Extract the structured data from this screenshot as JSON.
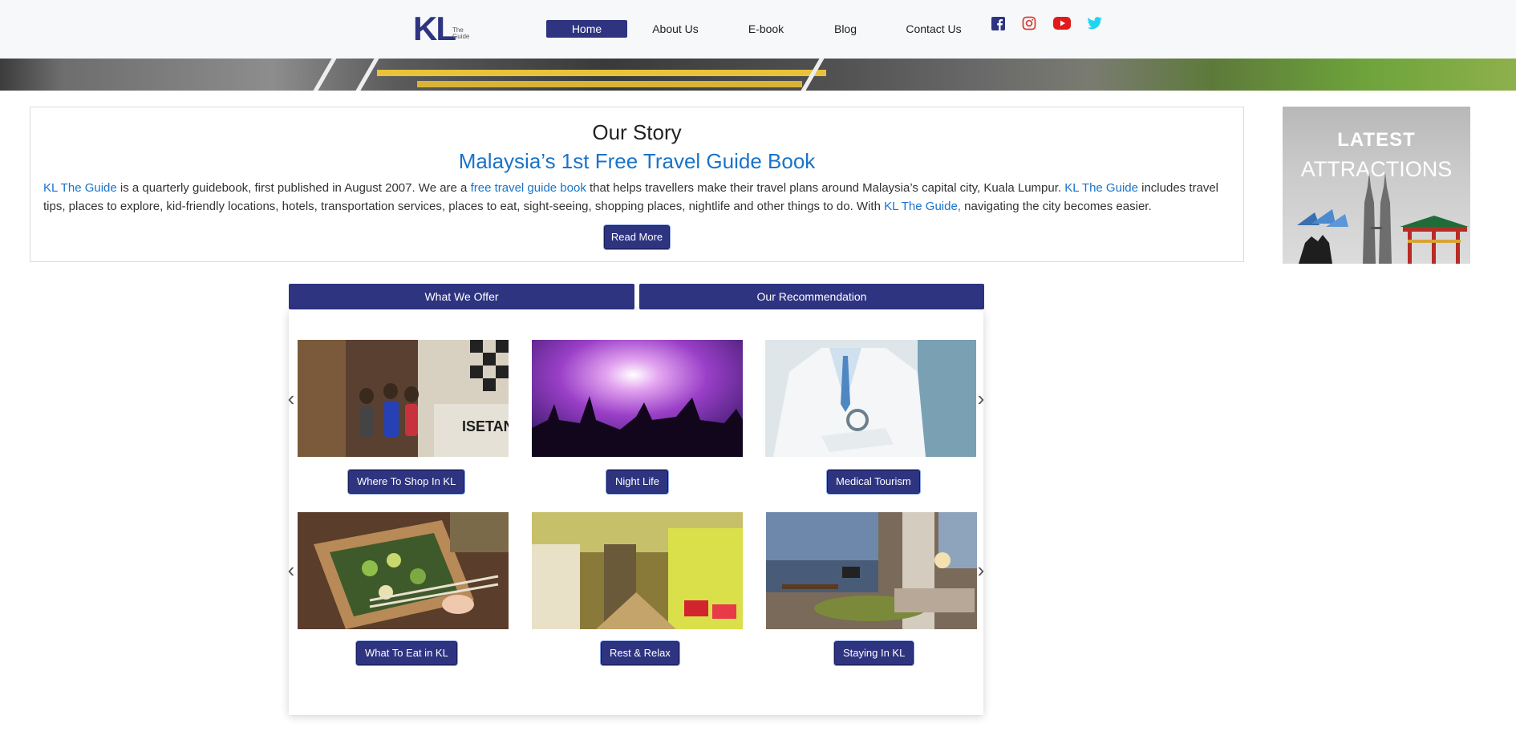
{
  "logo": {
    "main": "KL",
    "sub_line1": "The",
    "sub_line2": "Guide"
  },
  "nav": [
    {
      "label": "Home"
    },
    {
      "label": "About Us"
    },
    {
      "label": "E-book"
    },
    {
      "label": "Blog"
    },
    {
      "label": "Contact Us"
    }
  ],
  "social": [
    {
      "icon": "facebook-icon",
      "color": "#2e3480"
    },
    {
      "icon": "instagram-icon",
      "color": "#d0453a"
    },
    {
      "icon": "youtube-icon",
      "color": "#e11b1b"
    },
    {
      "icon": "twitter-icon",
      "color": "#1fd6f0"
    }
  ],
  "story": {
    "title": "Our Story",
    "subtitle": "Malaysia’s 1st Free Travel Guide Book",
    "p1_link": "KL The Guide",
    "p1_text": " is a quarterly guidebook, first published in August 2007. We are a ",
    "p2_link": "free travel guide book",
    "p2_text": " that helps travellers make their travel plans around Malaysia’s capital city, Kuala Lumpur. ",
    "p3_link": "KL The Guide",
    "p3_text": " includes travel tips, places to explore, kid-friendly locations, hotels, transportation services, places to eat, sight-seeing, shopping places, nightlife and other things to do. With ",
    "p4_link": "KL The Guide,",
    "p4_text": " navigating the city becomes easier.",
    "read_more": "Read More"
  },
  "latest": {
    "line1": "LATEST",
    "line2": "ATTRACTIONS"
  },
  "tabs": [
    {
      "label": "What We Offer"
    },
    {
      "label": "Our Recommendation"
    }
  ],
  "tiles": [
    {
      "label": "Where To Shop In KL"
    },
    {
      "label": "Night Life"
    },
    {
      "label": "Medical Tourism"
    },
    {
      "label": "What To Eat in KL"
    },
    {
      "label": "Rest & Relax"
    },
    {
      "label": "Staying In KL"
    }
  ],
  "colors": {
    "brand": "#2e3480",
    "link": "#1a73c9"
  }
}
